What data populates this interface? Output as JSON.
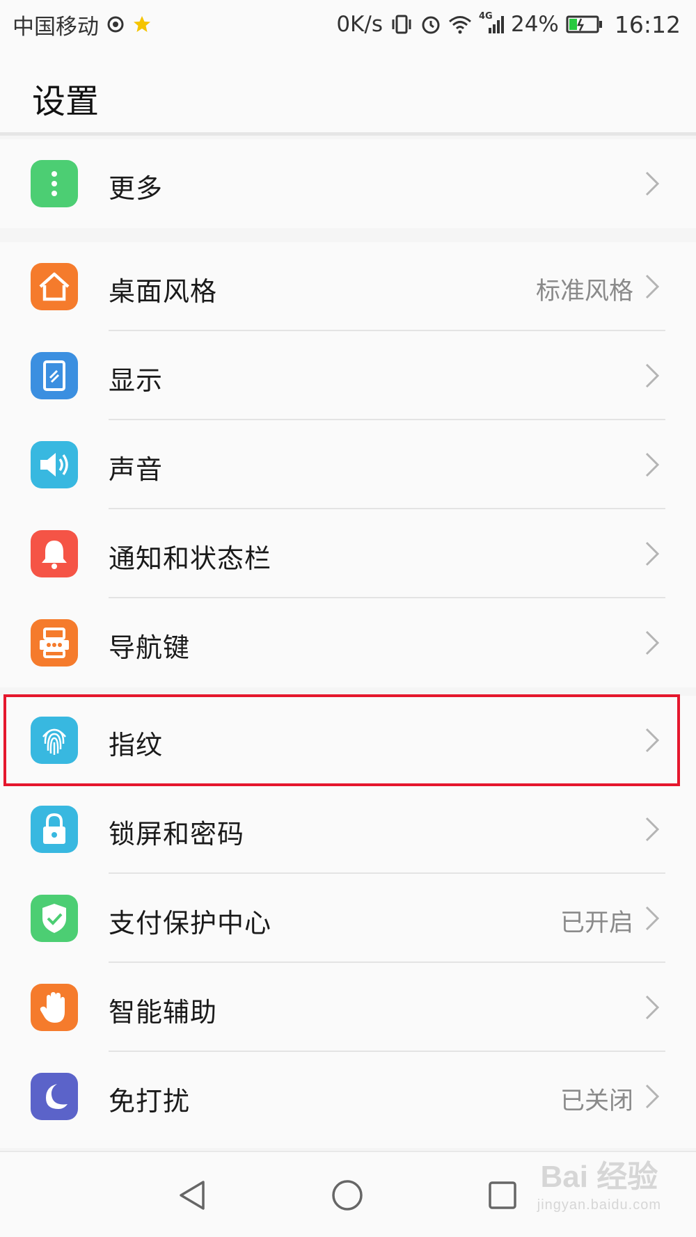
{
  "status_bar": {
    "carrier": "中国移动",
    "speed": "0K/s",
    "network": "4G",
    "battery": "24%",
    "time": "16:12"
  },
  "header": {
    "title": "设置"
  },
  "groups": [
    {
      "items": [
        {
          "label": "更多",
          "value": "",
          "icon": "more-dots-icon",
          "color": "#4cce73"
        }
      ]
    },
    {
      "items": [
        {
          "label": "桌面风格",
          "value": "标准风格",
          "icon": "home-icon",
          "color": "#f57b2c"
        },
        {
          "label": "显示",
          "value": "",
          "icon": "display-icon",
          "color": "#3b8fe0"
        },
        {
          "label": "声音",
          "value": "",
          "icon": "speaker-icon",
          "color": "#38b8e0"
        },
        {
          "label": "通知和状态栏",
          "value": "",
          "icon": "bell-icon",
          "color": "#f55446"
        },
        {
          "label": "导航键",
          "value": "",
          "icon": "nav-key-icon",
          "color": "#f57b2c"
        }
      ]
    },
    {
      "items": [
        {
          "label": "指纹",
          "value": "",
          "icon": "fingerprint-icon",
          "color": "#38b8e0"
        },
        {
          "label": "锁屏和密码",
          "value": "",
          "icon": "lock-icon",
          "color": "#38b8e0"
        },
        {
          "label": "支付保护中心",
          "value": "已开启",
          "icon": "shield-check-icon",
          "color": "#4cce73"
        },
        {
          "label": "智能辅助",
          "value": "",
          "icon": "hand-icon",
          "color": "#f57b2c"
        },
        {
          "label": "免打扰",
          "value": "已关闭",
          "icon": "moon-icon",
          "color": "#5b63c9"
        }
      ]
    }
  ],
  "highlight_color": "#e5172d",
  "watermark": {
    "main": "Bai 经验",
    "sub": "jingyan.baidu.com"
  }
}
